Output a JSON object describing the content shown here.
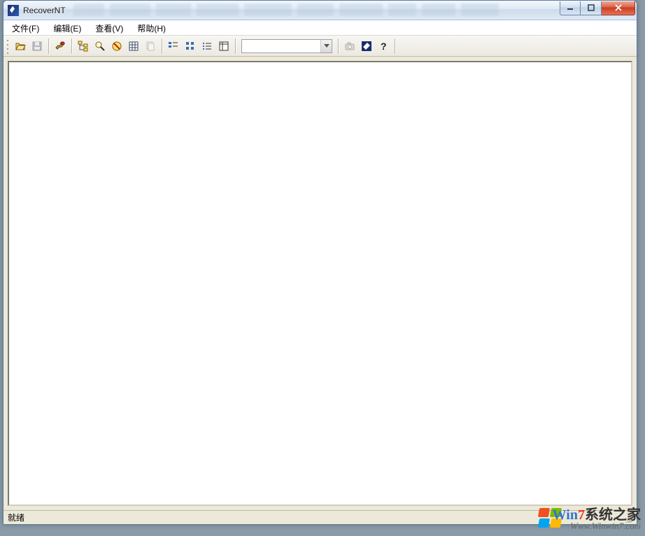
{
  "window": {
    "title": "RecoverNT"
  },
  "menu": {
    "items": [
      {
        "label": "文件(F)"
      },
      {
        "label": "编辑(E)"
      },
      {
        "label": "查看(V)"
      },
      {
        "label": "帮助(H)"
      }
    ]
  },
  "toolbar": {
    "buttons": {
      "open": "open-icon",
      "save": "save-icon",
      "tool": "wrench-icon",
      "tree": "tree-icon",
      "search": "search-icon",
      "filter": "filter-icon",
      "grid": "grid-icon",
      "copy": "copy-icon",
      "view_small": "small-icons-icon",
      "view_large": "large-icons-icon",
      "view_list": "list-icon",
      "view_detail": "detail-icon",
      "camera": "camera-icon",
      "app": "app-icon",
      "help": "help-icon"
    },
    "combo_value": ""
  },
  "status": {
    "text": "就绪"
  },
  "watermark": {
    "line1_a": "Win",
    "line1_b": "7",
    "line1_c": "系统之家",
    "line2": "Www.Winwin7.com"
  }
}
